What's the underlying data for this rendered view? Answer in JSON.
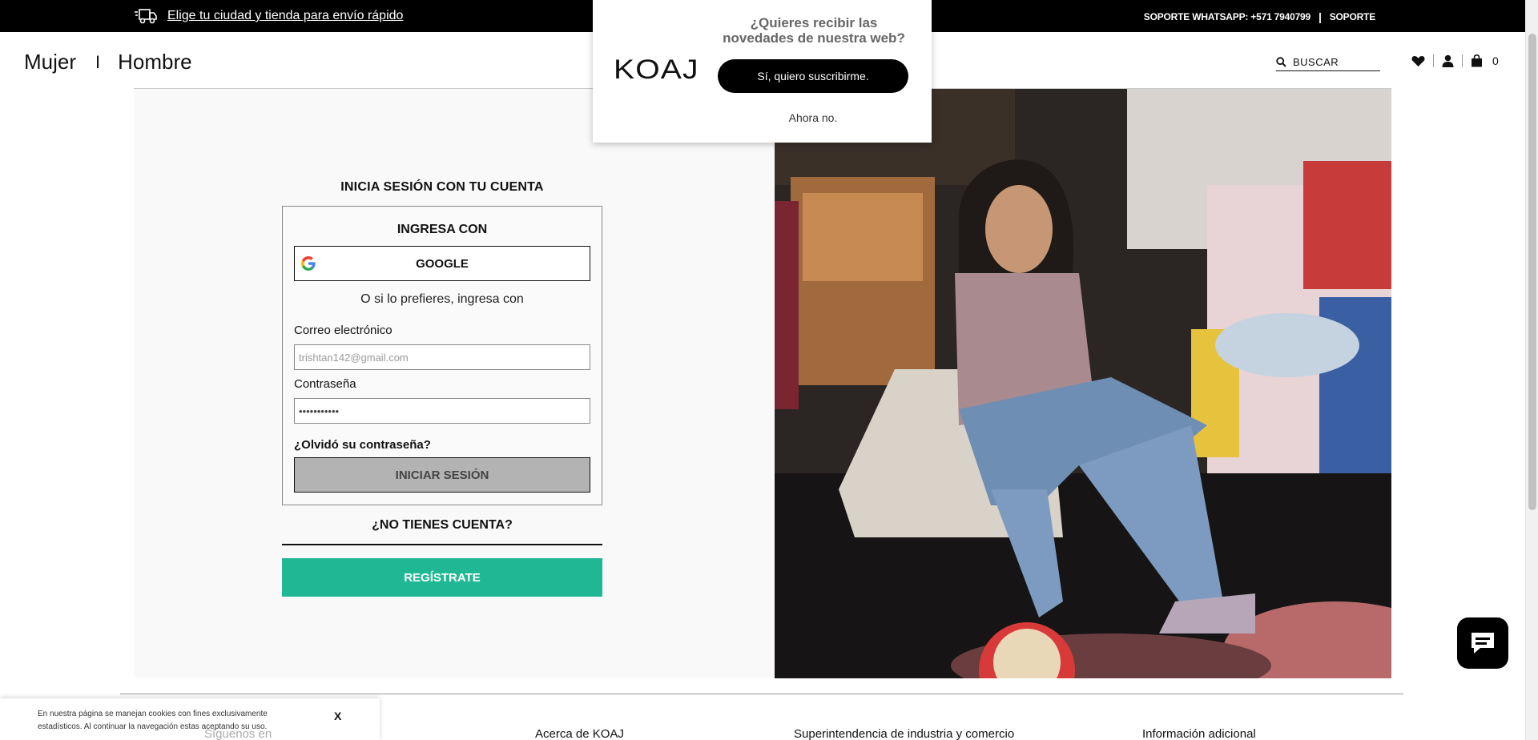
{
  "topbar": {
    "delivery_link": "Elige tu ciudad y tienda para envío rápido",
    "whatsapp": "SOPORTE WHATSAPP: +571 7940799",
    "separator": "|",
    "support": "SOPORTE"
  },
  "header": {
    "nav": {
      "women": "Mujer",
      "divider": "I",
      "men": "Hombre"
    },
    "search": {
      "placeholder": "BUSCAR"
    },
    "cart_count": "0"
  },
  "login": {
    "title": "INICIA SESIÓN CON TU CUENTA",
    "ingresa_con": "INGRESA CON",
    "google_label": "GOOGLE",
    "alt_text": "O si lo prefieres, ingresa con",
    "email_label": "Correo electrónico",
    "email_placeholder": "trishtan142@gmail.com",
    "password_label": "Contraseña",
    "password_value": "•••••••••••",
    "forgot": "¿Olvidó su contraseña?",
    "signin_label": "INICIAR SESIÓN"
  },
  "register": {
    "no_account": "¿NO TIENES CUENTA?",
    "register_label": "REGÍSTRATE"
  },
  "popup": {
    "logo": "KOAJ",
    "question": "¿Quieres recibir las novedades de nuestra web?",
    "yes": "Sí, quiero suscribirme.",
    "no": "Ahora no."
  },
  "footer": {
    "col_follow": "Síguenos en",
    "col_about": "Acerca de KOAJ",
    "col_sic": "Superintendencia de industria y comercio",
    "col_info": "Información adicional"
  },
  "cookie": {
    "text": "En nuestra página se manejan cookies con fines exclusivamente estadísticos. Al continuar la navegación estas aceptando su uso.",
    "close": "X"
  },
  "colors": {
    "accent_green": "#20b894",
    "topbar": "#000000"
  },
  "icons": [
    "truck-icon",
    "search-icon",
    "heart-icon",
    "user-icon",
    "bag-icon",
    "google-icon",
    "chat-icon"
  ]
}
